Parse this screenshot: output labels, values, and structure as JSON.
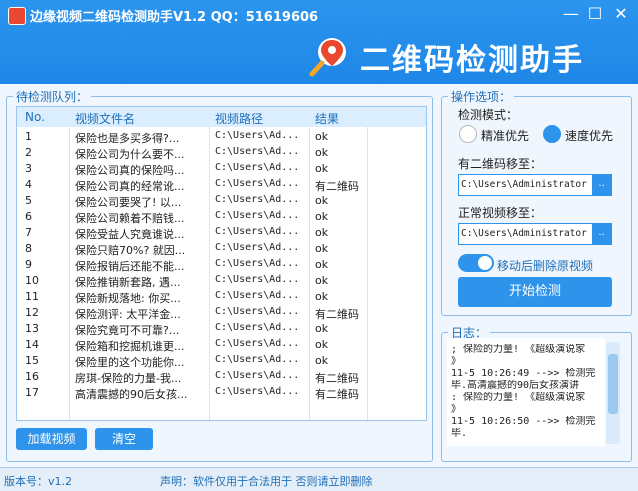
{
  "window": {
    "title": "边缘视频二维码检测助手V1.2  QQ：51619606",
    "banner": "二维码检测助手",
    "minimize": "—",
    "maximize": "☐",
    "close": "✕"
  },
  "queue": {
    "legend": "待检测队列：",
    "columns": [
      "No.",
      "视频文件名",
      "视频路径",
      "结果"
    ],
    "rows": [
      {
        "no": "1",
        "name": "保险也是多买多得?...",
        "path": "C:\\Users\\Ad...",
        "result": "ok"
      },
      {
        "no": "2",
        "name": "保险公司为什么要不...",
        "path": "C:\\Users\\Ad...",
        "result": "ok"
      },
      {
        "no": "3",
        "name": "保险公司真的保险吗...",
        "path": "C:\\Users\\Ad...",
        "result": "ok"
      },
      {
        "no": "4",
        "name": "保险公司真的经常讹...",
        "path": "C:\\Users\\Ad...",
        "result": "有二维码"
      },
      {
        "no": "5",
        "name": "保险公司要哭了! 以...",
        "path": "C:\\Users\\Ad...",
        "result": "ok"
      },
      {
        "no": "6",
        "name": "保险公司赖着不赔钱...",
        "path": "C:\\Users\\Ad...",
        "result": "ok"
      },
      {
        "no": "7",
        "name": "保险受益人究竟谁说...",
        "path": "C:\\Users\\Ad...",
        "result": "ok"
      },
      {
        "no": "8",
        "name": "保险只赔70%? 就因...",
        "path": "C:\\Users\\Ad...",
        "result": "ok"
      },
      {
        "no": "9",
        "name": "保险报销后还能不能...",
        "path": "C:\\Users\\Ad...",
        "result": "ok"
      },
      {
        "no": "10",
        "name": "保险推销新套路, 遇...",
        "path": "C:\\Users\\Ad...",
        "result": "ok"
      },
      {
        "no": "11",
        "name": "保险新规落地: 你买...",
        "path": "C:\\Users\\Ad...",
        "result": "ok"
      },
      {
        "no": "12",
        "name": "保险测评: 太平洋金...",
        "path": "C:\\Users\\Ad...",
        "result": "有二维码"
      },
      {
        "no": "13",
        "name": "保险究竟可不可靠?...",
        "path": "C:\\Users\\Ad...",
        "result": "ok"
      },
      {
        "no": "14",
        "name": "保险箱和挖掘机谁更...",
        "path": "C:\\Users\\Ad...",
        "result": "ok"
      },
      {
        "no": "15",
        "name": "保险里的这个功能你...",
        "path": "C:\\Users\\Ad...",
        "result": "ok"
      },
      {
        "no": "16",
        "name": "房琪-保险的力量-我...",
        "path": "C:\\Users\\Ad...",
        "result": "有二维码"
      },
      {
        "no": "17",
        "name": "高清震撼的90后女孩...",
        "path": "C:\\Users\\Ad...",
        "result": "有二维码"
      }
    ],
    "load_button": "加载视频",
    "clear_button": "清空"
  },
  "options": {
    "legend": "操作选项：",
    "mode_label": "检测模式：",
    "mode_accurate": "精准优先",
    "mode_fast": "速度优先",
    "qr_move_label": "有二维码移至：",
    "qr_move_path": "C:\\Users\\Administrator",
    "normal_move_label": "正常视频移至：",
    "normal_move_path": "C:\\Users\\Administrator",
    "browse": "..",
    "delete_toggle_label": "移动后删除原视频",
    "start_button": "开始检测"
  },
  "log": {
    "legend": "日志：",
    "lines": [
      "; 保险的力量! 《超级演说家",
      "》",
      "11-5 10:26:49 -->> 检测完",
      "毕.高清震撼的90后女孩演讲",
      ": 保险的力量! 《超级演说家",
      "》",
      "11-5 10:26:50 -->> 检测完",
      "毕."
    ]
  },
  "status": {
    "version": "版本号：v1.2",
    "notice": "声明：软件仅用于合法用于 否则请立即删除"
  },
  "colors": {
    "accent": "#2e93ea",
    "title_bg": "#2490ea",
    "brand_red": "#e9472f"
  }
}
